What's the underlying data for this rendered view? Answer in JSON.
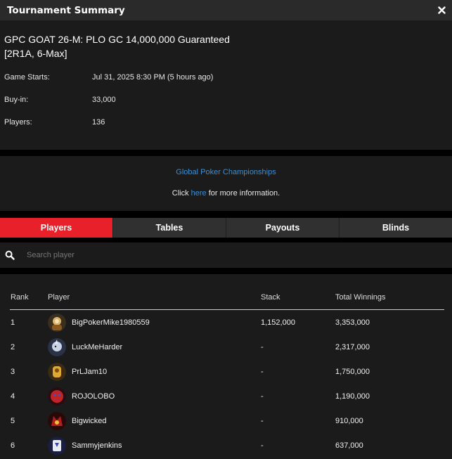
{
  "header": {
    "title": "Tournament Summary",
    "close_icon": "close-icon"
  },
  "tournament": {
    "name_line1": "GPC GOAT 26-M: PLO GC 14,000,000 Guaranteed",
    "name_line2": "[2R1A, 6-Max]",
    "details": [
      {
        "label": "Game Starts:",
        "value": "Jul 31, 2025 8:30 PM (5 hours ago)"
      },
      {
        "label": "Buy-in:",
        "value": "33,000"
      },
      {
        "label": "Players:",
        "value": "136"
      }
    ]
  },
  "promo": {
    "brand_link": "Global Poker Championships",
    "click": "Click",
    "here_link": "here",
    "suffix": "for more information."
  },
  "tabs": [
    {
      "label": "Players",
      "active": true
    },
    {
      "label": "Tables",
      "active": false
    },
    {
      "label": "Payouts",
      "active": false
    },
    {
      "label": "Blinds",
      "active": false
    }
  ],
  "search": {
    "placeholder": "Search player",
    "icon": "search-icon"
  },
  "table": {
    "headers": {
      "rank": "Rank",
      "player": "Player",
      "stack": "Stack",
      "winnings": "Total Winnings"
    },
    "rows": [
      {
        "rank": "1",
        "player": "BigPokerMike1980559",
        "stack": "1,152,000",
        "winnings": "3,353,000",
        "avatar_color": "#b07a2a"
      },
      {
        "rank": "2",
        "player": "LuckMeHarder",
        "stack": "-",
        "winnings": "2,317,000",
        "avatar_color": "#8a9ab8"
      },
      {
        "rank": "3",
        "player": "PrLJam10",
        "stack": "-",
        "winnings": "1,750,000",
        "avatar_color": "#c8962a"
      },
      {
        "rank": "4",
        "player": "ROJOLOBO",
        "stack": "-",
        "winnings": "1,190,000",
        "avatar_color": "#c0242a"
      },
      {
        "rank": "5",
        "player": "Bigwicked",
        "stack": "-",
        "winnings": "910,000",
        "avatar_color": "#b01e1e"
      },
      {
        "rank": "6",
        "player": "Sammyjenkins",
        "stack": "-",
        "winnings": "637,000",
        "avatar_color": "#3a4aa8"
      }
    ]
  },
  "colors": {
    "accent": "#e8202a",
    "link": "#3b8fd6",
    "panel": "#1b1b1b",
    "header": "#2a2a2a"
  }
}
